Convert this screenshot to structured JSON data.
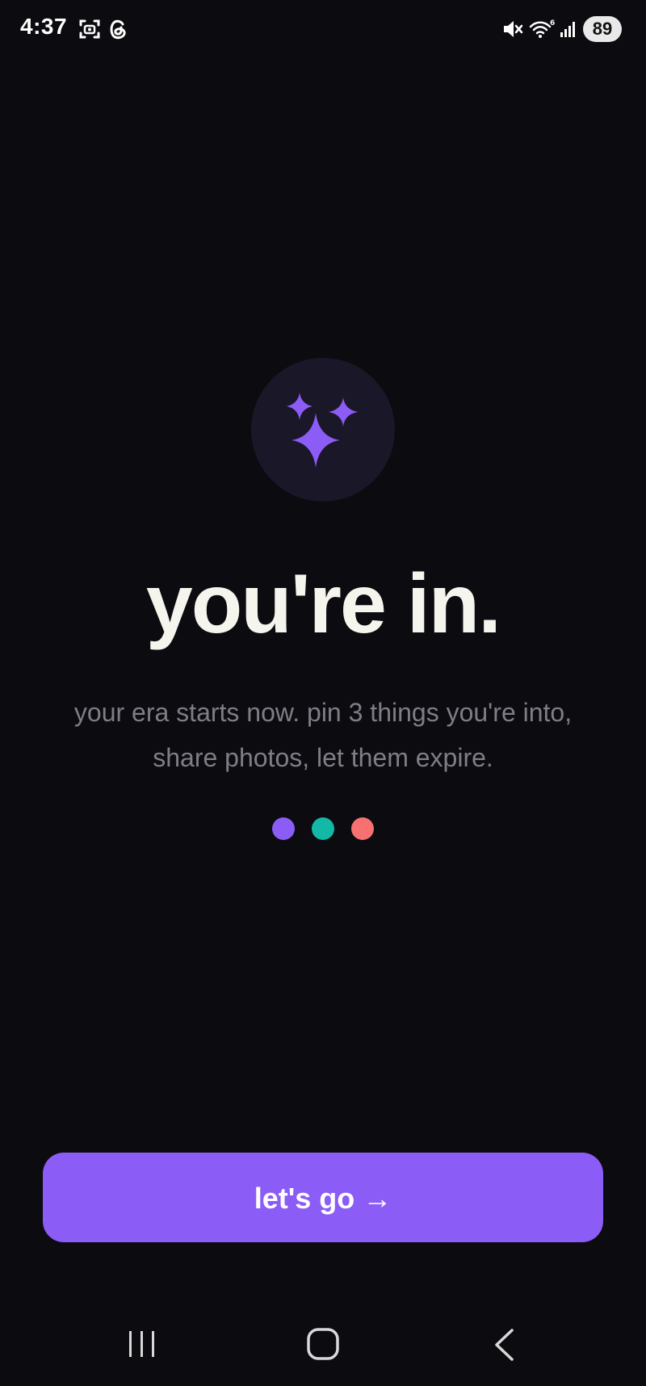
{
  "status_bar": {
    "time": "4:37",
    "battery": "89",
    "icons": [
      "screenshot-icon",
      "threads-icon",
      "mute-icon",
      "wifi-icon",
      "signal-icon"
    ]
  },
  "hero": {
    "icon": "sparkles-icon",
    "accent_color": "#8b5cf6"
  },
  "headline": "you're in.",
  "subtitle": "your era starts now. pin 3 things you're into, share photos, let them expire.",
  "dots": [
    {
      "color": "#8b5cf6"
    },
    {
      "color": "#14b8a6"
    },
    {
      "color": "#f87171"
    }
  ],
  "cta": {
    "label": "let's go →"
  },
  "nav_bar": {
    "icons": [
      "recent-apps-icon",
      "home-icon",
      "back-icon"
    ]
  }
}
